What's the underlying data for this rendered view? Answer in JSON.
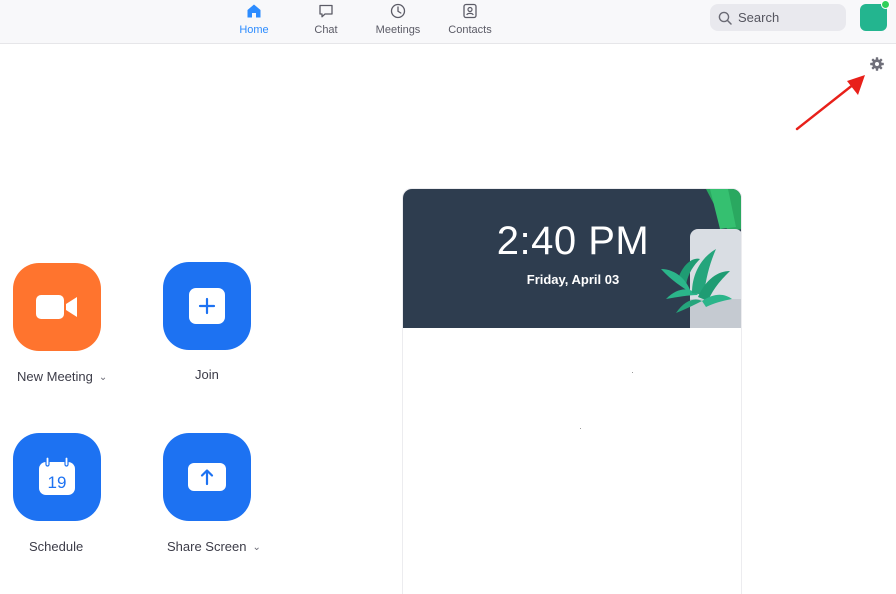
{
  "nav": {
    "tabs": [
      {
        "label": "Home",
        "icon": "home-icon",
        "active": true
      },
      {
        "label": "Chat",
        "icon": "chat-bubble-icon",
        "active": false
      },
      {
        "label": "Meetings",
        "icon": "clock-icon",
        "active": false
      },
      {
        "label": "Contacts",
        "icon": "contact-card-icon",
        "active": false
      }
    ]
  },
  "search": {
    "placeholder": "Search",
    "icon": "search-icon"
  },
  "profile": {
    "avatar_color": "#23b58f",
    "status_color": "#2fd05a"
  },
  "settings": {
    "icon": "gear-icon"
  },
  "actions": [
    {
      "label": "New Meeting",
      "icon": "video-camera-icon",
      "color": "#ff742e",
      "has_dropdown": true
    },
    {
      "label": "Join",
      "icon": "plus-icon",
      "color": "#1d72f2",
      "has_dropdown": false
    },
    {
      "label": "Schedule",
      "icon": "calendar-icon",
      "color": "#1d72f2",
      "has_dropdown": false,
      "calendar_day": "19"
    },
    {
      "label": "Share Screen",
      "icon": "share-arrow-icon",
      "color": "#1d72f2",
      "has_dropdown": true
    }
  ],
  "clock_card": {
    "time": "2:40 PM",
    "date": "Friday, April 03",
    "banner_color": "#2e3d4f"
  },
  "colors": {
    "accent": "#2d8cff",
    "annotation_arrow": "#e8201a"
  }
}
